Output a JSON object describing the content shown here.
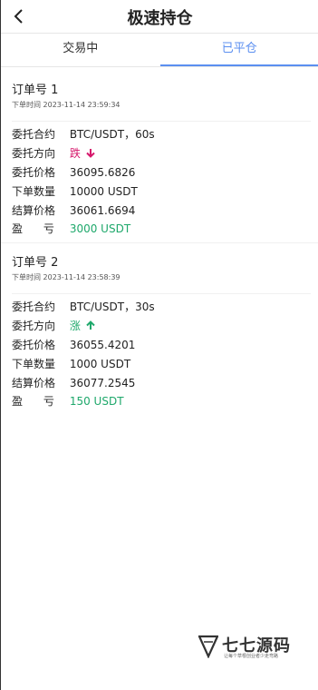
{
  "header": {
    "title": "极速持仓"
  },
  "tabs": [
    {
      "label": "交易中"
    },
    {
      "label": "已平仓"
    }
  ],
  "orders": [
    {
      "order_no": "订单号  1",
      "time": "下单时间  2023-11-14 23:59:34",
      "contract_label": "委托合约",
      "contract_value": "BTC/USDT，60s",
      "direction_label": "委托方向",
      "direction_value": "跌",
      "direction_icon": "arrow-down-icon",
      "price_label": "委托价格",
      "price_value": "36095.6826",
      "qty_label": "下单数量",
      "qty_value": "10000 USDT",
      "settle_label": "结算价格",
      "settle_value": "36061.6694",
      "pl_label": "盈      亏",
      "pl_value": "3000 USDT"
    },
    {
      "order_no": "订单号  2",
      "time": "下单时间  2023-11-14 23:58:39",
      "contract_label": "委托合约",
      "contract_value": "BTC/USDT，30s",
      "direction_label": "委托方向",
      "direction_value": "涨",
      "direction_icon": "arrow-up-icon",
      "price_label": "委托价格",
      "price_value": "36055.4201",
      "qty_label": "下单数量",
      "qty_value": "1000 USDT",
      "settle_label": "结算价格",
      "settle_value": "36077.2545",
      "pl_label": "盈      亏",
      "pl_value": "150 USDT"
    }
  ],
  "watermark": {
    "title": "七七源码",
    "subtitle": "让每个草根创业者少走弯路"
  },
  "colors": {
    "accent": "#5b8ff0",
    "down": "#d6176b",
    "up": "#1ea86b"
  }
}
